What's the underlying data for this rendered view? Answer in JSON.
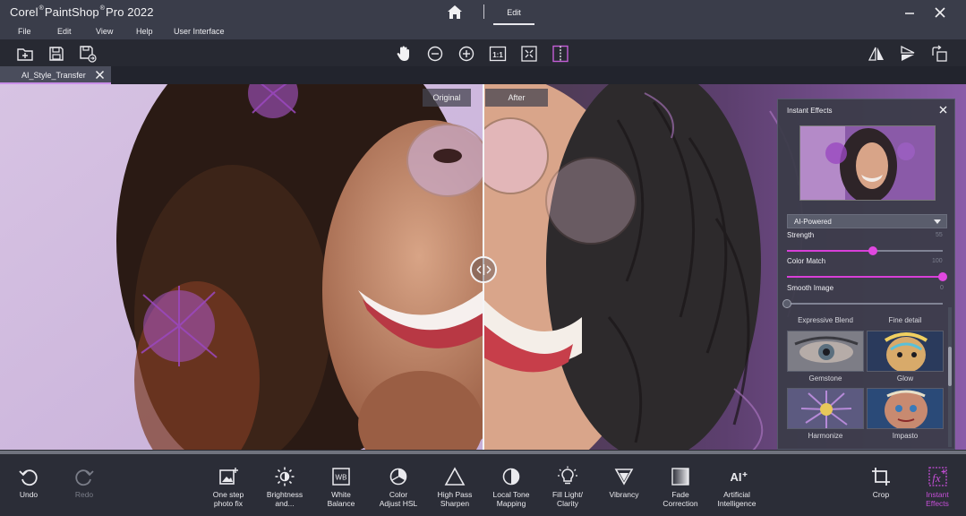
{
  "app": {
    "title_left": "Corel",
    "title_mid": "PaintShop",
    "title_right": "Pro 2022",
    "mode_tab": "Edit"
  },
  "menu": {
    "items": [
      "File",
      "Edit",
      "View",
      "Help",
      "User Interface"
    ]
  },
  "document": {
    "tab_label": "AI_Style_Transfer"
  },
  "compare": {
    "original_label": "Original",
    "after_label": "After"
  },
  "instant_effects": {
    "title": "Instant Effects",
    "category": "AI-Powered",
    "strength": {
      "label": "Strength",
      "value": 55
    },
    "color_match": {
      "label": "Color Match",
      "value": 100
    },
    "smooth_image": {
      "label": "Smooth Image",
      "value": 0
    },
    "presets": [
      {
        "label": "Expressive Blend"
      },
      {
        "label": "Fine detail"
      },
      {
        "label": "Gemstone"
      },
      {
        "label": "Glow"
      },
      {
        "label": "Harmonize"
      },
      {
        "label": "Impasto"
      }
    ]
  },
  "bottom_tools": {
    "undo": "Undo",
    "redo": "Redo",
    "one_step_1": "One step",
    "one_step_2": "photo fix",
    "brightness_1": "Brightness",
    "brightness_2": "and...",
    "white_balance_1": "White",
    "white_balance_2": "Balance",
    "color_adjust_1": "Color",
    "color_adjust_2": "Adjust HSL",
    "high_pass_1": "High Pass",
    "high_pass_2": "Sharpen",
    "local_tone_1": "Local Tone",
    "local_tone_2": "Mapping",
    "fill_light_1": "Fill Light/",
    "fill_light_2": "Clarity",
    "vibrancy": "Vibrancy",
    "fade_1": "Fade",
    "fade_2": "Correction",
    "ai_1": "Artificial",
    "ai_2": "Intelligence",
    "ai_icon_text": "AI",
    "wb_icon_text": "WB",
    "crop": "Crop",
    "instant_effects_1": "Instant",
    "instant_effects_2": "Effects",
    "fx_icon_text": "fx"
  },
  "colors": {
    "accent": "#d83fd8",
    "active_label": "#c44ed6",
    "titlebar": "#3a3d4a",
    "bottombar": "#2b2d37"
  }
}
